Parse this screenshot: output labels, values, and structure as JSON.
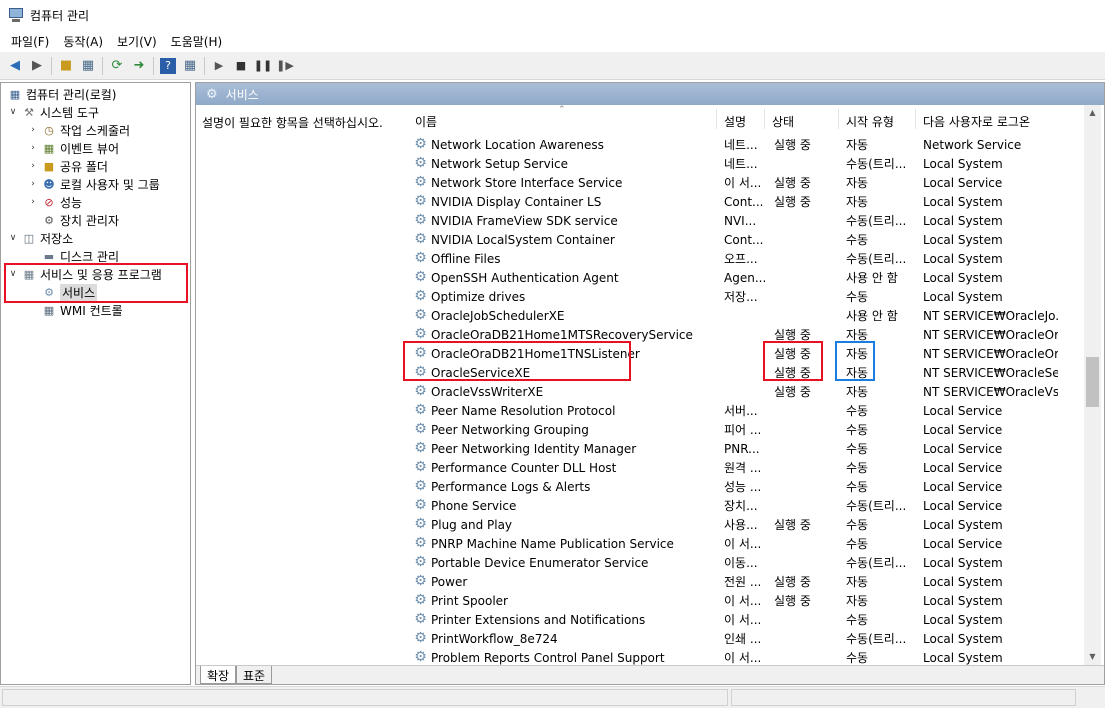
{
  "window": {
    "title": "컴퓨터 관리"
  },
  "menu": [
    "파일(F)",
    "동작(A)",
    "보기(V)",
    "도움말(H)"
  ],
  "toolbar": {
    "buttons": [
      "back-icon",
      "forward-icon",
      "up-folder-icon",
      "show-hide-tree-icon",
      "refresh-icon",
      "export-icon",
      "help-icon",
      "properties-icon",
      "start-icon",
      "stop-icon",
      "pause-icon",
      "restart-icon"
    ]
  },
  "tree": {
    "root": "컴퓨터 관리(로컬)",
    "system_tools": "시스템 도구",
    "task_scheduler": "작업 스케줄러",
    "event_viewer": "이벤트 뷰어",
    "shared_folders": "공유 폴더",
    "local_users": "로컬 사용자 및 그룹",
    "performance": "성능",
    "device_manager": "장치 관리자",
    "storage": "저장소",
    "disk_management": "디스크 관리",
    "services_apps": "서비스 및 응용 프로그램",
    "services": "서비스",
    "wmi": "WMI 컨트롤"
  },
  "panel": {
    "header": "서비스",
    "description": "설명이 필요한 항목을 선택하십시오."
  },
  "columns": {
    "name": "이름",
    "desc": "설명",
    "status": "상태",
    "startup": "시작 유형",
    "logon": "다음 사용자로 로그온"
  },
  "services": [
    {
      "name": "Network Location Awareness",
      "desc": "네트...",
      "status": "실행 중",
      "startup": "자동",
      "logon": "Network Service"
    },
    {
      "name": "Network Setup Service",
      "desc": "네트...",
      "status": "",
      "startup": "수동(트리...",
      "logon": "Local System"
    },
    {
      "name": "Network Store Interface Service",
      "desc": "이 서...",
      "status": "실행 중",
      "startup": "자동",
      "logon": "Local Service"
    },
    {
      "name": "NVIDIA Display Container LS",
      "desc": "Cont...",
      "status": "실행 중",
      "startup": "자동",
      "logon": "Local System"
    },
    {
      "name": "NVIDIA FrameView SDK service",
      "desc": "NVI...",
      "status": "",
      "startup": "수동(트리...",
      "logon": "Local System"
    },
    {
      "name": "NVIDIA LocalSystem Container",
      "desc": "Cont...",
      "status": "",
      "startup": "수동",
      "logon": "Local System"
    },
    {
      "name": "Offline Files",
      "desc": "오프...",
      "status": "",
      "startup": "수동(트리...",
      "logon": "Local System"
    },
    {
      "name": "OpenSSH Authentication Agent",
      "desc": "Agen...",
      "status": "",
      "startup": "사용 안 함",
      "logon": "Local System"
    },
    {
      "name": "Optimize drives",
      "desc": "저장...",
      "status": "",
      "startup": "수동",
      "logon": "Local System"
    },
    {
      "name": "OracleJobSchedulerXE",
      "desc": "",
      "status": "",
      "startup": "사용 안 함",
      "logon": "NT SERVICE₩OracleJo..."
    },
    {
      "name": "OracleOraDB21Home1MTSRecoveryService",
      "desc": "",
      "status": "실행 중",
      "startup": "자동",
      "logon": "NT SERVICE₩OracleOr..."
    },
    {
      "name": "OracleOraDB21Home1TNSListener",
      "desc": "",
      "status": "실행 중",
      "startup": "자동",
      "logon": "NT SERVICE₩OracleOr..."
    },
    {
      "name": "OracleServiceXE",
      "desc": "",
      "status": "실행 중",
      "startup": "자동",
      "logon": "NT SERVICE₩OracleSe..."
    },
    {
      "name": "OracleVssWriterXE",
      "desc": "",
      "status": "실행 중",
      "startup": "자동",
      "logon": "NT SERVICE₩OracleVs..."
    },
    {
      "name": "Peer Name Resolution Protocol",
      "desc": "서버...",
      "status": "",
      "startup": "수동",
      "logon": "Local Service"
    },
    {
      "name": "Peer Networking Grouping",
      "desc": "피어 ...",
      "status": "",
      "startup": "수동",
      "logon": "Local Service"
    },
    {
      "name": "Peer Networking Identity Manager",
      "desc": "PNR...",
      "status": "",
      "startup": "수동",
      "logon": "Local Service"
    },
    {
      "name": "Performance Counter DLL Host",
      "desc": "원격 ...",
      "status": "",
      "startup": "수동",
      "logon": "Local Service"
    },
    {
      "name": "Performance Logs & Alerts",
      "desc": "성능 ...",
      "status": "",
      "startup": "수동",
      "logon": "Local Service"
    },
    {
      "name": "Phone Service",
      "desc": "장치...",
      "status": "",
      "startup": "수동(트리...",
      "logon": "Local Service"
    },
    {
      "name": "Plug and Play",
      "desc": "사용...",
      "status": "실행 중",
      "startup": "수동",
      "logon": "Local System"
    },
    {
      "name": "PNRP Machine Name Publication Service",
      "desc": "이 서...",
      "status": "",
      "startup": "수동",
      "logon": "Local Service"
    },
    {
      "name": "Portable Device Enumerator Service",
      "desc": "이동...",
      "status": "",
      "startup": "수동(트리...",
      "logon": "Local System"
    },
    {
      "name": "Power",
      "desc": "전원 ...",
      "status": "실행 중",
      "startup": "자동",
      "logon": "Local System"
    },
    {
      "name": "Print Spooler",
      "desc": "이 서...",
      "status": "실행 중",
      "startup": "자동",
      "logon": "Local System"
    },
    {
      "name": "Printer Extensions and Notifications",
      "desc": "이 서...",
      "status": "",
      "startup": "수동",
      "logon": "Local System"
    },
    {
      "name": "PrintWorkflow_8e724",
      "desc": "인쇄 ...",
      "status": "",
      "startup": "수동(트리...",
      "logon": "Local System"
    },
    {
      "name": "Problem Reports Control Panel Support",
      "desc": "이 서...",
      "status": "",
      "startup": "수동",
      "logon": "Local System"
    }
  ],
  "tabs": [
    "확장",
    "표준"
  ],
  "colors": {
    "highlight_red": "#e81123",
    "highlight_blue": "#1a7ee0",
    "header_bar": "#9bb4d2"
  }
}
